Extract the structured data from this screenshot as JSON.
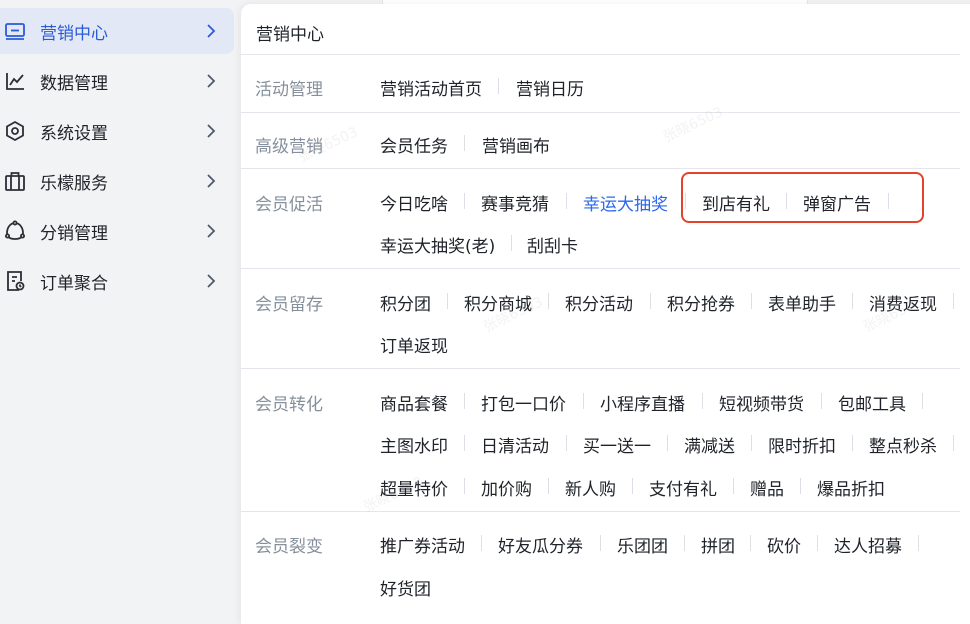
{
  "sidebar": {
    "items": [
      {
        "label": "营销中心",
        "icon": "monitor-icon",
        "active": true
      },
      {
        "label": "数据管理",
        "icon": "line-chart-icon"
      },
      {
        "label": "系统设置",
        "icon": "hexagon-settings-icon"
      },
      {
        "label": "乐檬服务",
        "icon": "briefcase-icon"
      },
      {
        "label": "分销管理",
        "icon": "share-nodes-icon"
      },
      {
        "label": "订单聚合",
        "icon": "order-document-icon"
      }
    ]
  },
  "panel": {
    "title": "营销中心",
    "groups": [
      {
        "label": "活动管理",
        "rows": [
          [
            "营销活动首页",
            "营销日历"
          ]
        ]
      },
      {
        "label": "高级营销",
        "rows": [
          [
            "会员任务",
            "营销画布"
          ]
        ]
      },
      {
        "label": "会员促活",
        "rows": [
          [
            "今日吃啥",
            "赛事竞猜",
            "幸运大抽奖",
            "到店有礼",
            "弹窗广告"
          ],
          [
            "幸运大抽奖(老)",
            "刮刮卡"
          ]
        ]
      },
      {
        "label": "会员留存",
        "rows": [
          [
            "积分团",
            "积分商城",
            "积分活动",
            "积分抢券",
            "表单助手",
            "消费返现"
          ],
          [
            "订单返现"
          ]
        ]
      },
      {
        "label": "会员转化",
        "rows": [
          [
            "商品套餐",
            "打包一口价",
            "小程序直播",
            "短视频带货",
            "包邮工具"
          ],
          [
            "主图水印",
            "日清活动",
            "买一送一",
            "满减送",
            "限时折扣",
            "整点秒杀"
          ],
          [
            "超量特价",
            "加价购",
            "新人购",
            "支付有礼",
            "赠品",
            "爆品折扣"
          ]
        ]
      },
      {
        "label": "会员裂变",
        "rows": [
          [
            "推广券活动",
            "好友瓜分券",
            "乐团团",
            "拼团",
            "砍价",
            "达人招募"
          ],
          [
            "好货团"
          ]
        ]
      }
    ]
  },
  "watermark": "张晓6503",
  "colors": {
    "accent": "#2a68ee",
    "active_bg": "#e3e8f6",
    "highlight": "#e4432b"
  }
}
